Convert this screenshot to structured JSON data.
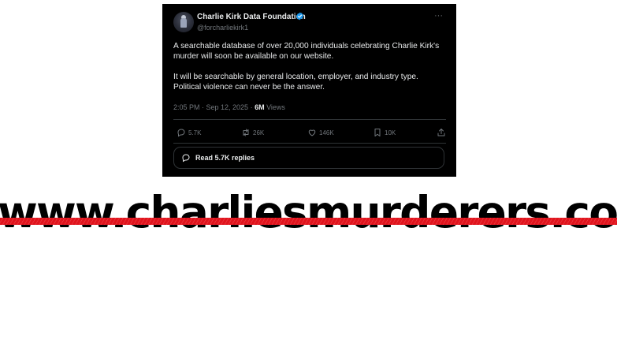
{
  "tweet": {
    "display_name": "Charlie Kirk Data Foundation",
    "handle": "@forcharliekirk1",
    "verified": true,
    "more_icon": "more-icon",
    "body_paragraphs": [
      "A searchable database of over 20,000 individuals celebrating Charlie Kirk's murder will soon be available on our website.",
      "It will be searchable by general location, employer, and industry type. Political violence can never be the answer."
    ],
    "timestamp": "2:05 PM · Sep 12, 2025 · ",
    "views_count": "6M",
    "views_label": " Views",
    "actions": {
      "replies": "5.7K",
      "reposts": "26K",
      "likes": "146K",
      "bookmarks": "10K"
    },
    "read_replies_label": "Read 5.7K replies",
    "colors": {
      "background": "#000000",
      "text": "#e7e9ea",
      "muted": "#71767b",
      "verified": "#1d9bf0"
    }
  },
  "overlay": {
    "url_text": "www.charliesmurderers.com",
    "strike_color": "#e0141d"
  }
}
